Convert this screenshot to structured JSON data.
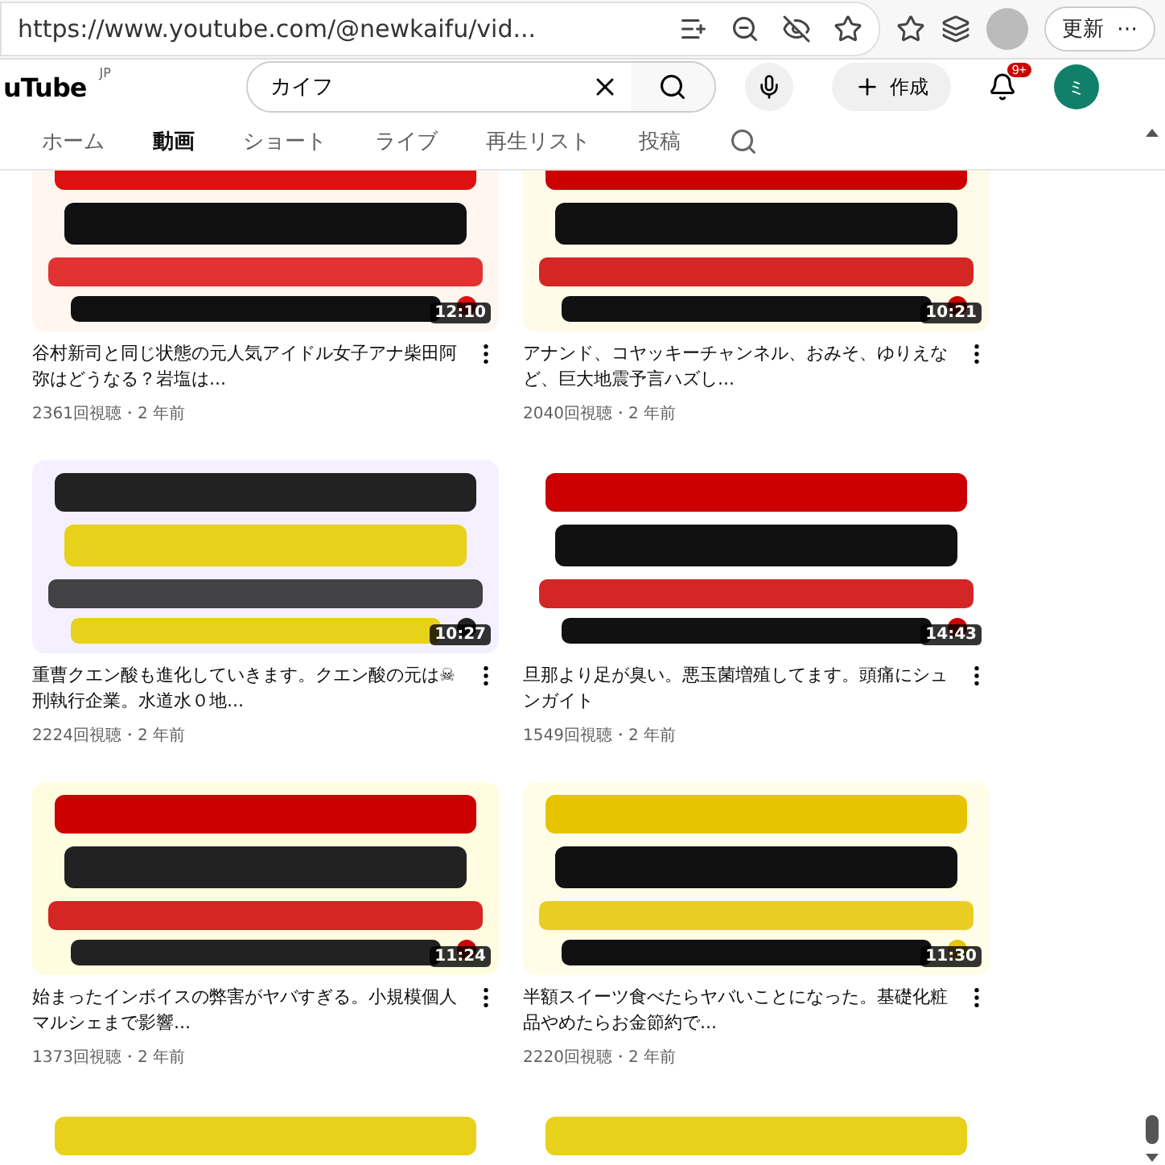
{
  "browser": {
    "url": "https://www.youtube.com/@newkaifu/vid...",
    "update_button": "更新",
    "more": "⋯"
  },
  "header": {
    "logo": "uTube",
    "region": "JP",
    "search": {
      "value": "カイフ"
    },
    "create": "作成",
    "notifications": "9+",
    "avatar": "ミ"
  },
  "tabs": [
    {
      "label": "ホーム",
      "selected": false
    },
    {
      "label": "動画",
      "selected": true
    },
    {
      "label": "ショート",
      "selected": false
    },
    {
      "label": "ライブ",
      "selected": false
    },
    {
      "label": "再生リスト",
      "selected": false
    },
    {
      "label": "投稿",
      "selected": false
    }
  ],
  "videos": [
    {
      "kind": "video",
      "duration": "12:10",
      "title": "谷村新司と同じ状態の元人気アイドル女子アナ柴田阿弥はどうなる？岩塩は...",
      "meta": "2361回視聴・2 年前"
    },
    {
      "kind": "video",
      "duration": "10:21",
      "title": "アナンド、コヤッキーチャンネル、おみそ、ゆりえなど、巨大地震予言ハズし...",
      "meta": "2040回視聴・2 年前"
    },
    {
      "kind": "video",
      "duration": "10:27",
      "title": "重曹クエン酸も進化していきます。クエン酸の元は☠刑執行企業。水道水０地...",
      "meta": "2224回視聴・2 年前"
    },
    {
      "kind": "video",
      "duration": "14:43",
      "title": "旦那より足が臭い。悪玉菌増殖してます。頭痛にシュンガイト",
      "meta": "1549回視聴・2 年前"
    },
    {
      "kind": "video",
      "duration": "11:24",
      "title": "始まったインボイスの弊害がヤバすぎる。小規模個人マルシェまで影響...",
      "meta": "1373回視聴・2 年前"
    },
    {
      "kind": "video",
      "duration": "11:30",
      "title": "半額スイーツ食べたらヤバいことになった。基礎化粧品やめたらお金節約で...",
      "meta": "2220回視聴・2 年前"
    },
    {
      "kind": "picture"
    },
    {
      "kind": "picture"
    }
  ]
}
